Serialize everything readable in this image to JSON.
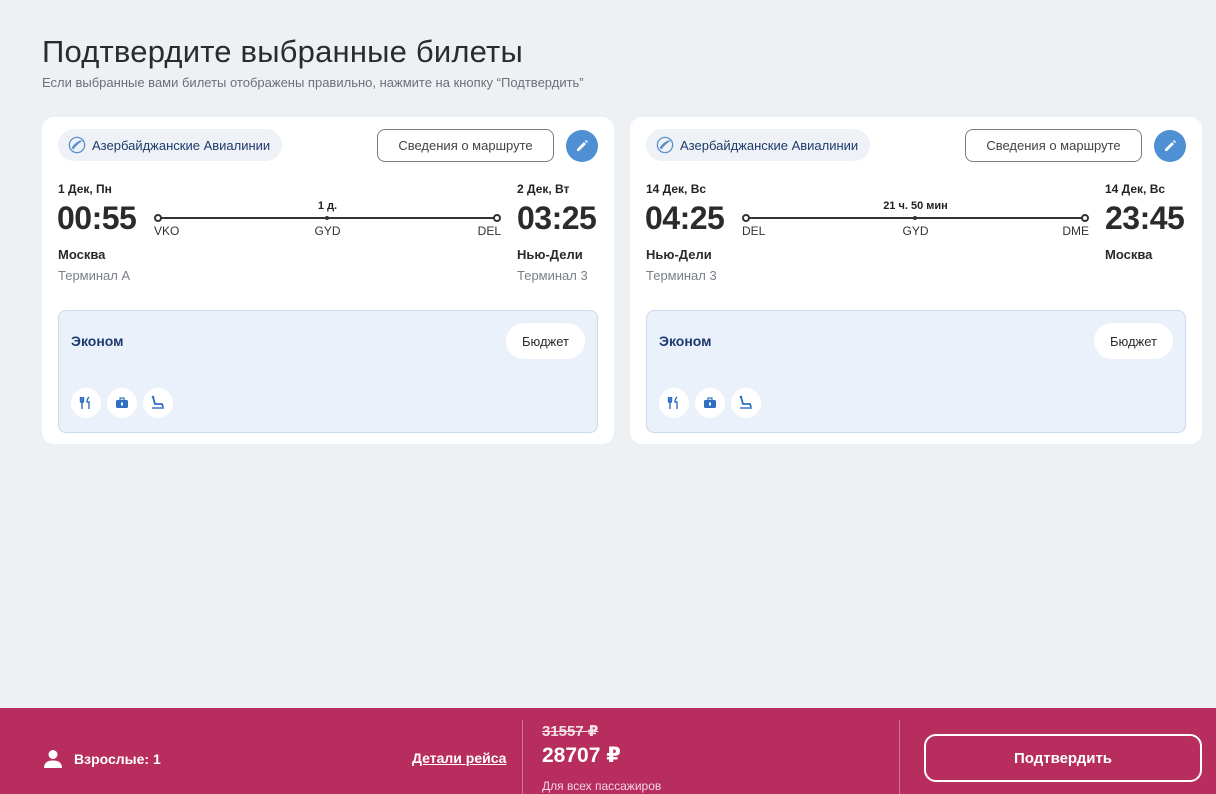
{
  "header": {
    "title": "Подтвердите выбранные билеты",
    "subtitle": "Если выбранные вами билеты отображены правильно, нажмите на кнопку “Подтвердить”"
  },
  "colors": {
    "accent": "#b72d5e",
    "edit": "#4f8fd4",
    "fare_bg": "#eaf1fb",
    "airline_text": "#1f3a6e"
  },
  "flights": [
    {
      "airline": "Азербайджанские Авиалинии",
      "route_button": "Сведения о маршруте",
      "edit_icon": "pencil-icon",
      "departure": {
        "date": "1 Дек, Пн",
        "time": "00:55",
        "city": "Москва",
        "terminal": "Терминал A",
        "code": "VKO"
      },
      "arrival": {
        "date": "2 Дек, Вт",
        "time": "03:25",
        "city": "Нью-Дели",
        "terminal": "Терминал 3",
        "code": "DEL"
      },
      "duration": "1 д.",
      "stop": "GYD",
      "fare": {
        "class": "Эконом",
        "badge": "Бюджет",
        "icons": [
          "meal-icon",
          "baggage-icon",
          "seat-icon"
        ]
      }
    },
    {
      "airline": "Азербайджанские Авиалинии",
      "route_button": "Сведения о маршруте",
      "edit_icon": "pencil-icon",
      "departure": {
        "date": "14 Дек, Вс",
        "time": "04:25",
        "city": "Нью-Дели",
        "terminal": "Терминал 3",
        "code": "DEL"
      },
      "arrival": {
        "date": "14 Дек, Вс",
        "time": "23:45",
        "city": "Москва",
        "terminal": "",
        "code": "DME"
      },
      "duration": "21 ч. 50 мин",
      "stop": "GYD",
      "fare": {
        "class": "Эконом",
        "badge": "Бюджет",
        "icons": [
          "meal-icon",
          "baggage-icon",
          "seat-icon"
        ]
      }
    }
  ],
  "footer": {
    "passengers": "Взрослые: 1",
    "details_link": "Детали рейса",
    "old_price": "31557 ₽",
    "new_price": "28707 ₽",
    "price_note": "Для всех пассажиров",
    "confirm": "Подтвердить"
  }
}
